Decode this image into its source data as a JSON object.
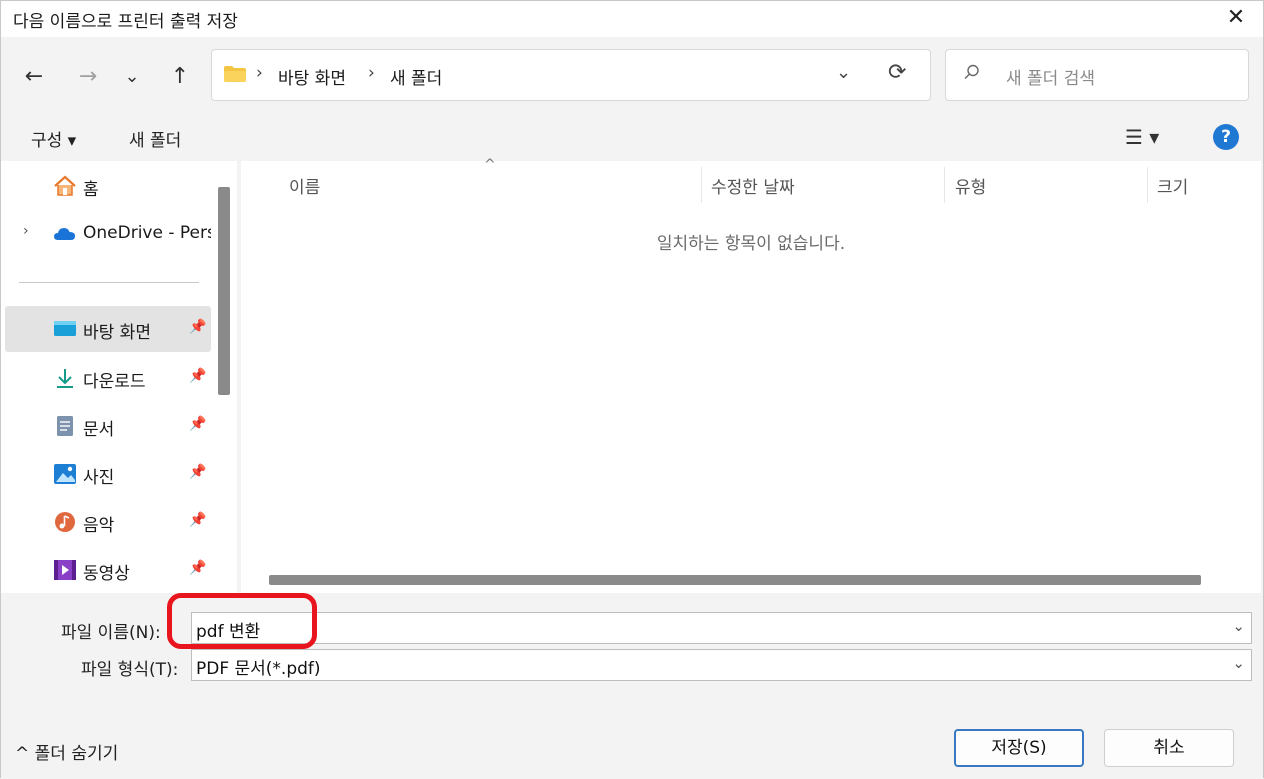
{
  "window": {
    "title": "다음 이름으로 프린터 출력 저장",
    "close_glyph": "✕"
  },
  "nav": {
    "back_glyph": "←",
    "forward_glyph": "→",
    "recent_glyph": "⌄",
    "up_glyph": "↑",
    "breadcrumb": [
      "바탕 화면",
      "새 폴더"
    ],
    "sep_glyph": "›",
    "dropdown_glyph": "⌄",
    "refresh_glyph": "⟳"
  },
  "search": {
    "placeholder": "새 폴더 검색"
  },
  "toolbar": {
    "organize_label": "구성 ▾",
    "new_folder_label": "새 폴더",
    "view_glyph": "☰ ▾",
    "help_glyph": "?"
  },
  "sidebar": {
    "items": [
      {
        "label": "홈",
        "icon": "home-icon",
        "expandable": false,
        "pinned": false
      },
      {
        "label": "OneDrive - Pers",
        "icon": "onedrive-icon",
        "expandable": true,
        "pinned": false
      },
      {
        "label": "바탕 화면",
        "icon": "desktop-icon",
        "pinned": true,
        "selected": true
      },
      {
        "label": "다운로드",
        "icon": "download-icon",
        "pinned": true
      },
      {
        "label": "문서",
        "icon": "documents-icon",
        "pinned": true
      },
      {
        "label": "사진",
        "icon": "pictures-icon",
        "pinned": true
      },
      {
        "label": "음악",
        "icon": "music-icon",
        "pinned": true
      },
      {
        "label": "동영상",
        "icon": "videos-icon",
        "pinned": true
      }
    ],
    "expand_glyph": "›",
    "pin_glyph": "📌"
  },
  "filelist": {
    "columns": [
      "이름",
      "수정한 날짜",
      "유형",
      "크기"
    ],
    "sort_glyph": "^",
    "empty_message": "일치하는 항목이 없습니다."
  },
  "form": {
    "filename_label": "파일 이름(N):",
    "filename_value": "pdf 변환",
    "filetype_label": "파일 형식(T):",
    "filetype_value": "PDF 문서(*.pdf)",
    "dropdown_glyph": "⌄"
  },
  "footer": {
    "hide_folders_label": "^ 폴더 숨기기",
    "save_label": "저장(S)",
    "cancel_label": "취소"
  },
  "colors": {
    "accent": "#1f78d1",
    "highlight": "#e8141e",
    "folder": "#f4c542"
  }
}
